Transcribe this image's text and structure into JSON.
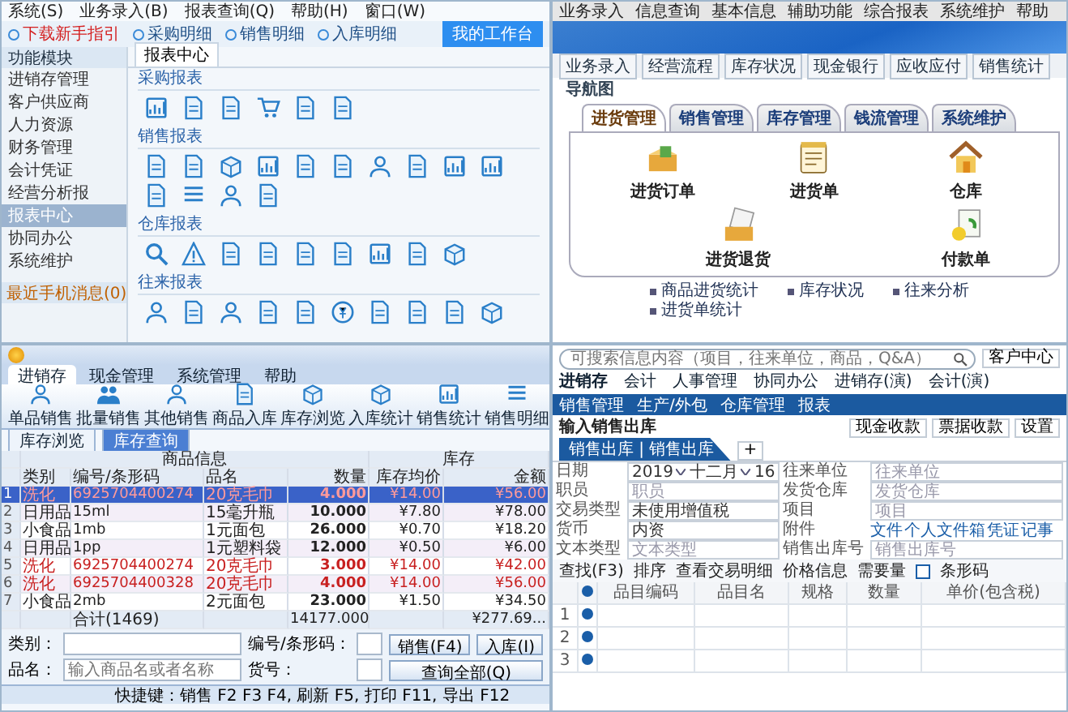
{
  "reports_window": {
    "menu": [
      "系统(S)",
      "业务录入(B)",
      "报表查询(Q)",
      "帮助(H)",
      "窗口(W)"
    ],
    "toolbar": [
      {
        "label": "下载新手指引",
        "highlight": true
      },
      {
        "label": "采购明细",
        "highlight": false
      },
      {
        "label": "销售明细",
        "highlight": false
      },
      {
        "label": "入库明细",
        "highlight": false
      }
    ],
    "workbench_button": "我的工作台",
    "sidebar": {
      "title": "功能模块",
      "items": [
        {
          "label": "进销存管理",
          "selected": false
        },
        {
          "label": "客户供应商",
          "selected": false
        },
        {
          "label": "人力资源",
          "selected": false
        },
        {
          "label": "财务管理",
          "selected": false
        },
        {
          "label": "会计凭证",
          "selected": false
        },
        {
          "label": "经营分析报",
          "selected": false
        },
        {
          "label": "报表中心",
          "selected": true
        },
        {
          "label": "协同办公",
          "selected": false
        },
        {
          "label": "系统维护",
          "selected": false
        }
      ],
      "messages": "最近手机消息(0)"
    },
    "tab": "报表中心",
    "sections": [
      {
        "title": "采购报表",
        "icons": [
          {
            "kind": "chart"
          },
          {
            "kind": "doc"
          },
          {
            "kind": "doc"
          },
          {
            "kind": "cart"
          },
          {
            "kind": "doc"
          },
          {
            "kind": "doc"
          }
        ]
      },
      {
        "title": "销售报表",
        "icons": [
          {
            "kind": "doc"
          },
          {
            "kind": "doc"
          },
          {
            "kind": "box"
          },
          {
            "kind": "chart"
          },
          {
            "kind": "doc"
          },
          {
            "kind": "doc"
          },
          {
            "kind": "person"
          },
          {
            "kind": "doc"
          },
          {
            "kind": "chart"
          },
          {
            "kind": "chart"
          },
          {
            "kind": "doc"
          },
          {
            "kind": "list"
          },
          {
            "kind": "person"
          },
          {
            "kind": "doc"
          }
        ]
      },
      {
        "title": "仓库报表",
        "icons": [
          {
            "kind": "search"
          },
          {
            "kind": "warning"
          },
          {
            "kind": "doc"
          },
          {
            "kind": "doc"
          },
          {
            "kind": "doc"
          },
          {
            "kind": "doc"
          },
          {
            "kind": "chart"
          },
          {
            "kind": "doc"
          },
          {
            "kind": "box"
          }
        ]
      },
      {
        "title": "往来报表",
        "icons": [
          {
            "kind": "person"
          },
          {
            "kind": "doc"
          },
          {
            "kind": "person"
          },
          {
            "kind": "doc"
          },
          {
            "kind": "doc"
          },
          {
            "kind": "coin"
          },
          {
            "kind": "doc"
          },
          {
            "kind": "doc"
          },
          {
            "kind": "doc"
          },
          {
            "kind": "box"
          }
        ]
      }
    ]
  },
  "navigator_window": {
    "menu": [
      "业务录入",
      "信息查询",
      "基本信息",
      "辅助功能",
      "综合报表",
      "系统维护",
      "帮助"
    ],
    "toolbar": [
      "业务录入",
      "经营流程",
      "库存状况",
      "现金银行",
      "应收应付",
      "销售统计"
    ],
    "tab": "导航图",
    "module_tabs": [
      {
        "label": "进货管理",
        "selected": true
      },
      {
        "label": "销售管理",
        "selected": false
      },
      {
        "label": "库存管理",
        "selected": false
      },
      {
        "label": "钱流管理",
        "selected": false
      },
      {
        "label": "系统维护",
        "selected": false
      }
    ],
    "modules": [
      {
        "label": "进货订单",
        "kind": "order"
      },
      {
        "label": "进货单",
        "kind": "note"
      },
      {
        "label": "仓库",
        "kind": "house"
      },
      {
        "label": "进货退货",
        "kind": "return"
      },
      {
        "label": "付款单",
        "kind": "payment"
      }
    ],
    "links": [
      "商品进货统计",
      "库存状况",
      "往来分析",
      "进货单统计"
    ]
  },
  "stock_window": {
    "ribbon_tabs": [
      {
        "label": "进销存",
        "selected": true
      },
      {
        "label": "现金管理",
        "selected": false
      },
      {
        "label": "系统管理",
        "selected": false
      },
      {
        "label": "帮助",
        "selected": false
      }
    ],
    "ribbon_buttons": [
      {
        "label": "单品销售",
        "kind": "person"
      },
      {
        "label": "批量销售",
        "kind": "people"
      },
      {
        "label": "其他销售",
        "kind": "person"
      },
      {
        "label": "商品入库",
        "kind": "doc"
      },
      {
        "label": "库存浏览",
        "kind": "box"
      },
      {
        "label": "入库统计",
        "kind": "box"
      },
      {
        "label": "销售统计",
        "kind": "chart"
      },
      {
        "label": "销售明细",
        "kind": "list"
      }
    ],
    "doc_tabs": [
      {
        "label": "库存浏览",
        "selected": false
      },
      {
        "label": "库存查询",
        "selected": true
      }
    ],
    "table": {
      "groups": [
        "商品信息",
        "库存"
      ],
      "columns": [
        "类别",
        "编号/条形码",
        "品名",
        "数量",
        "库存均价",
        "金额"
      ],
      "rows": [
        {
          "number": "1",
          "cells": [
            "洗化",
            "6925704400274",
            "20克毛巾",
            "4.000",
            "¥14.00",
            "¥56.00"
          ],
          "selected": true,
          "flagged": true
        },
        {
          "number": "2",
          "cells": [
            "日用品",
            "15ml",
            "15毫升瓶",
            "10.000",
            "¥7.80",
            "¥78.00"
          ],
          "selected": false,
          "flagged": false
        },
        {
          "number": "3",
          "cells": [
            "小食品",
            "1mb",
            "1元面包",
            "26.000",
            "¥0.70",
            "¥18.20"
          ],
          "selected": false,
          "flagged": false
        },
        {
          "number": "4",
          "cells": [
            "日用品",
            "1pp",
            "1元塑料袋",
            "12.000",
            "¥0.50",
            "¥6.00"
          ],
          "selected": false,
          "flagged": false
        },
        {
          "number": "5",
          "cells": [
            "洗化",
            "6925704400274",
            "20克毛巾",
            "3.000",
            "¥14.00",
            "¥42.00"
          ],
          "selected": false,
          "flagged": true
        },
        {
          "number": "6",
          "cells": [
            "洗化",
            "6925704400328",
            "20克毛巾",
            "4.000",
            "¥14.00",
            "¥56.00"
          ],
          "selected": false,
          "flagged": true
        },
        {
          "number": "7",
          "cells": [
            "小食品",
            "2mb",
            "2元面包",
            "23.000",
            "¥1.50",
            "¥34.50"
          ],
          "selected": false,
          "flagged": false
        }
      ],
      "total": {
        "label": "合计(1469)",
        "quantity": "14177.000",
        "amount": "¥277.69..."
      }
    },
    "query": {
      "fields": [
        {
          "label": "类别："
        },
        {
          "label": "编号/条形码："
        },
        {
          "label": "品名：",
          "placeholder": "输入商品名或者名称"
        },
        {
          "label": "货号："
        }
      ],
      "buttons": [
        "销售(F4)",
        "入库(I)",
        "查询全部(Q)"
      ]
    },
    "status": "快捷键：销售 F2 F3 F4, 刷新 F5, 打印 F11, 导出 F12"
  },
  "sales_window": {
    "search": {
      "placeholder": "可搜索信息内容（项目，往来单位，商品，Q&A）"
    },
    "customer_center": "客户中心",
    "nav": [
      {
        "label": "进销存",
        "selected": true
      },
      {
        "label": "会计",
        "selected": false
      },
      {
        "label": "人事管理",
        "selected": false
      },
      {
        "label": "协同办公",
        "selected": false
      },
      {
        "label": "进销存(演)",
        "selected": false
      },
      {
        "label": "会计(演)",
        "selected": false
      }
    ],
    "subnav": [
      "销售管理",
      "生产/外包",
      "仓库管理",
      "报表"
    ],
    "title": "输入销售出库",
    "title_buttons": [
      "现金收款",
      "票据收款",
      "设置"
    ],
    "tabs": [
      {
        "label": "销售出库 | 销售出库",
        "selected": true
      }
    ],
    "add_tab": "+",
    "form": [
      {
        "label": "日期",
        "kind": "date",
        "parts": [
          "2019",
          "十二月",
          "16"
        ]
      },
      {
        "label": "往来单位",
        "kind": "lookup",
        "placeholder": "往来单位"
      },
      {
        "label": "职员",
        "kind": "lookup",
        "placeholder": "职员"
      },
      {
        "label": "发货仓库",
        "kind": "lookup",
        "placeholder": "发货仓库"
      },
      {
        "label": "交易类型",
        "kind": "select",
        "value": "未使用增值税"
      },
      {
        "label": "项目",
        "kind": "lookup",
        "placeholder": "项目"
      },
      {
        "label": "货币",
        "kind": "select",
        "value": "内资"
      },
      {
        "label": "附件",
        "kind": "links",
        "links": [
          "文件",
          "个人文件箱",
          "凭证",
          "记事"
        ]
      },
      {
        "label": "文本类型",
        "kind": "text",
        "placeholder": "文本类型"
      },
      {
        "label": "销售出库号",
        "kind": "text",
        "placeholder": "销售出库号"
      }
    ],
    "toolbar": [
      "查找(F3)",
      "排序",
      "查看交易明细",
      "价格信息",
      "需要量"
    ],
    "barcode": {
      "label": "条形码",
      "checked": false
    },
    "grid": {
      "columns": [
        "品目编码",
        "品目名",
        "规格",
        "数量",
        "单价(包含税)"
      ],
      "rows": [
        "1",
        "2",
        "3"
      ]
    }
  }
}
